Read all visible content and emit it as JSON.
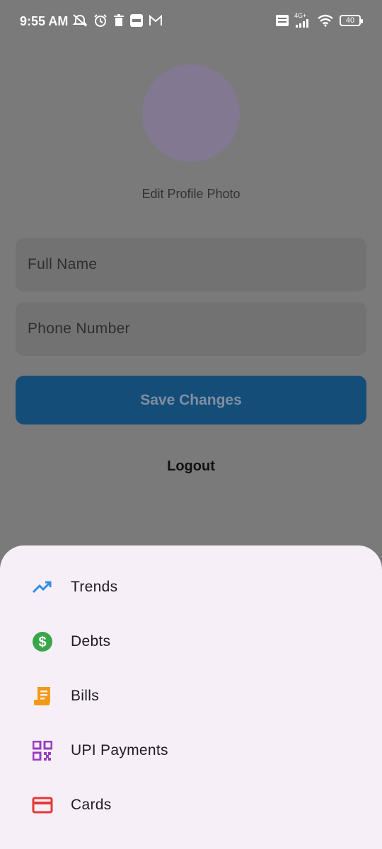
{
  "status_bar": {
    "time": "9:55 AM",
    "battery": "40",
    "network": "4G+",
    "icons_left": [
      "mute-icon",
      "alarm-icon",
      "trash-icon",
      "paytm-icon",
      "gmail-icon"
    ],
    "icons_right": [
      "volte-icon",
      "signal-icon",
      "wifi-icon",
      "battery-icon"
    ]
  },
  "profile": {
    "edit_photo_label": "Edit Profile Photo",
    "avatar_color": "#827891"
  },
  "form": {
    "full_name_placeholder": "Full Name",
    "phone_placeholder": "Phone Number",
    "save_label": "Save Changes",
    "logout_label": "Logout"
  },
  "bottom_sheet": {
    "items": [
      {
        "label": "Trends",
        "icon": "trending-up-icon",
        "color": "#2f8fe0"
      },
      {
        "label": "Debts",
        "icon": "dollar-circle-icon",
        "color": "#3aa64a"
      },
      {
        "label": "Bills",
        "icon": "receipt-icon",
        "color": "#f29a13"
      },
      {
        "label": "UPI Payments",
        "icon": "qr-code-icon",
        "color": "#9b3cc0"
      },
      {
        "label": "Cards",
        "icon": "credit-card-icon",
        "color": "#e53935"
      }
    ]
  }
}
